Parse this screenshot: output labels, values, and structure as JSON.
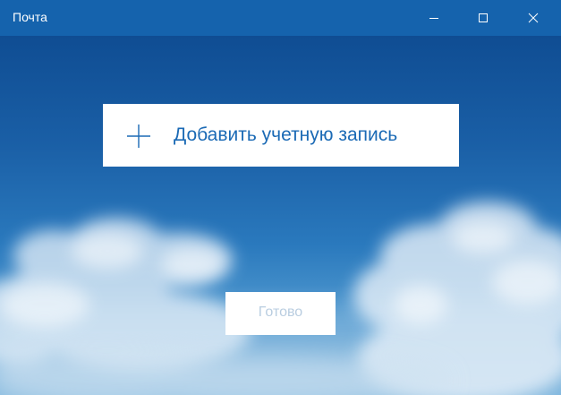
{
  "window": {
    "title": "Почта"
  },
  "title_bar": {
    "minimize_icon": "minimize-icon",
    "maximize_icon": "maximize-icon",
    "close_icon": "close-icon"
  },
  "main": {
    "add_account_label": "Добавить учетную запись",
    "add_account_icon": "plus-icon",
    "done_label": "Готово",
    "done_enabled": false
  },
  "colors": {
    "title_bar": "#1563ad",
    "accent_text": "#1b6ab5",
    "disabled_text": "#b9cde0",
    "button_bg": "#ffffff"
  }
}
